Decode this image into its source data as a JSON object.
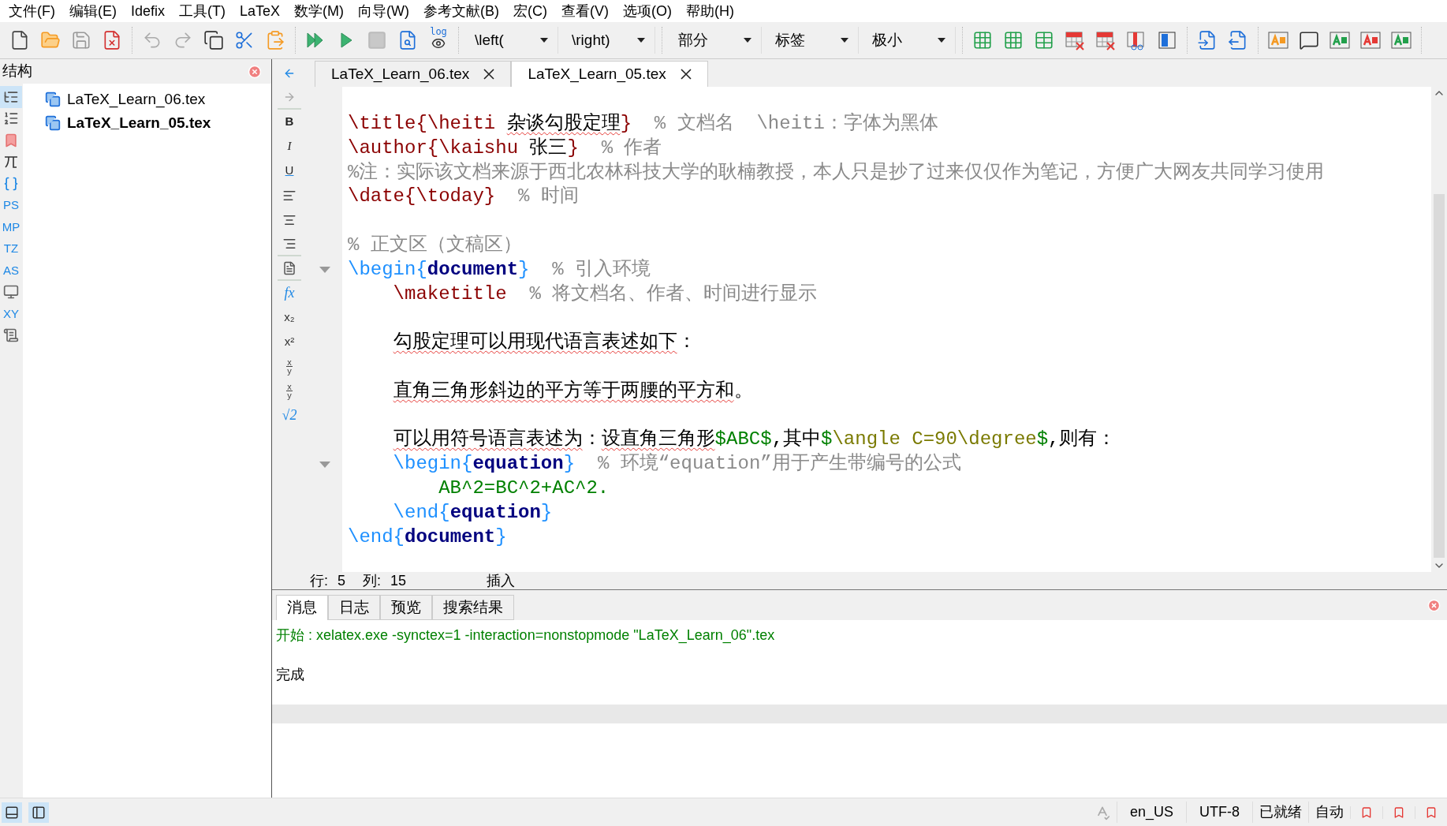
{
  "menu": [
    "文件(F)",
    "编辑(E)",
    "Idefix",
    "工具(T)",
    "LaTeX",
    "数学(M)",
    "向导(W)",
    "参考文献(B)",
    "宏(C)",
    "查看(V)",
    "选项(O)",
    "帮助(H)"
  ],
  "toolbar": [
    [
      {
        "kind": "new"
      },
      {
        "kind": "open"
      },
      {
        "kind": "save"
      },
      {
        "kind": "close"
      }
    ],
    [
      {
        "kind": "undo"
      },
      {
        "kind": "redo"
      },
      {
        "kind": "copy"
      },
      {
        "kind": "cut"
      },
      {
        "kind": "paste"
      }
    ],
    [
      {
        "kind": "quickbuild"
      },
      {
        "kind": "run"
      },
      {
        "kind": "stop"
      },
      {
        "kind": "view"
      },
      {
        "kind": "log",
        "label": "log"
      }
    ],
    [
      {
        "kind": "dropdown",
        "label": "\\left("
      },
      {
        "kind": "dropdown",
        "label": "\\right)"
      }
    ],
    [
      {
        "kind": "dropdown",
        "label": "部分"
      },
      {
        "kind": "dropdown",
        "label": "标签"
      },
      {
        "kind": "dropdown",
        "label": "极小"
      }
    ],
    [
      {
        "kind": "table",
        "color": "#22a04b"
      },
      {
        "kind": "table",
        "color": "#22a04b"
      },
      {
        "kind": "tablepaste",
        "color": "#22a04b"
      },
      {
        "kind": "tabledel",
        "color": "#e53935"
      },
      {
        "kind": "tabledel",
        "color": "#e53935"
      },
      {
        "kind": "tablecut",
        "color": "#e53935"
      },
      {
        "kind": "tablealign",
        "color": "#1e6fd9"
      }
    ],
    [
      {
        "kind": "docleft"
      },
      {
        "kind": "docright"
      }
    ],
    [
      {
        "kind": "textbox",
        "color": "#f59a23"
      },
      {
        "kind": "comment"
      },
      {
        "kind": "textbox",
        "color": "#22a04b"
      },
      {
        "kind": "textbox",
        "color": "#e53935"
      },
      {
        "kind": "textbox",
        "color": "#22a04b"
      }
    ]
  ],
  "structure": {
    "title": "结构",
    "tools": [
      {
        "kind": "tree",
        "selected": true
      },
      {
        "kind": "outline",
        "selected": false
      },
      {
        "kind": "bookmark",
        "selected": false
      },
      {
        "kind": "pi",
        "selected": false
      },
      {
        "kind": "braces",
        "selected": false
      },
      {
        "kind": "text",
        "label": "PS",
        "selected": false
      },
      {
        "kind": "text",
        "label": "MP",
        "selected": false
      },
      {
        "kind": "text",
        "label": "TZ",
        "selected": false
      },
      {
        "kind": "text",
        "label": "AS",
        "selected": false
      },
      {
        "kind": "screen",
        "selected": false
      },
      {
        "kind": "text",
        "label": "XY",
        "selected": false
      },
      {
        "kind": "script",
        "selected": false
      }
    ],
    "files": [
      {
        "name": "LaTeX_Learn_06.tex",
        "current": false
      },
      {
        "name": "LaTeX_Learn_05.tex",
        "current": true
      }
    ]
  },
  "format_bar": [
    {
      "kind": "back"
    },
    {
      "kind": "forward"
    },
    {
      "kind": "bold",
      "label": "B"
    },
    {
      "kind": "italic",
      "label": "I"
    },
    {
      "kind": "underline",
      "label": "U"
    },
    {
      "kind": "alignleft"
    },
    {
      "kind": "aligncenter"
    },
    {
      "kind": "alignright"
    },
    {
      "kind": "doc"
    },
    {
      "kind": "formula",
      "label": "fx"
    },
    {
      "kind": "script",
      "label": "x₂"
    },
    {
      "kind": "script",
      "label": "x²"
    },
    {
      "kind": "frac",
      "top": "x",
      "bottom": "y"
    },
    {
      "kind": "frac",
      "top": "x",
      "bottom": "y"
    },
    {
      "kind": "formula",
      "label": "√2"
    }
  ],
  "tabs": [
    {
      "label": "LaTeX_Learn_06.tex",
      "selected": false
    },
    {
      "label": "LaTeX_Learn_05.tex",
      "selected": true
    }
  ],
  "code": [
    {
      "fold": false,
      "segments": [
        {
          "kind": "cmd",
          "text": "\\title{\\heiti "
        },
        {
          "kind": "misspelled",
          "text": "杂谈勾股定理"
        },
        {
          "kind": "cmd",
          "text": "}"
        },
        {
          "kind": "comment",
          "text": "  % 文档名  \\heiti：字体为黑体"
        }
      ]
    },
    {
      "fold": false,
      "segments": [
        {
          "kind": "cmd",
          "text": "\\author{\\kaishu "
        },
        {
          "kind": "text",
          "text": "张三"
        },
        {
          "kind": "cmd",
          "text": "}"
        },
        {
          "kind": "comment",
          "text": "  % 作者"
        }
      ]
    },
    {
      "fold": false,
      "segments": [
        {
          "kind": "comment",
          "text": "%注：实际该文档来源于西北农林科技大学的耿楠教授，本人只是抄了过来仅仅作为笔记，方便广大网友共同学习使用"
        }
      ]
    },
    {
      "fold": false,
      "segments": [
        {
          "kind": "cmd",
          "text": "\\date{\\today}"
        },
        {
          "kind": "comment",
          "text": "  % 时间"
        }
      ]
    },
    {
      "fold": false
    },
    {
      "fold": false,
      "segments": [
        {
          "kind": "comment",
          "text": "% 正文区（文稿区）"
        }
      ]
    },
    {
      "fold": true,
      "segments": [
        {
          "kind": "env_cmd",
          "text": "\\begin{"
        },
        {
          "kind": "env_name",
          "text": "document"
        },
        {
          "kind": "env_cmd",
          "text": "}"
        },
        {
          "kind": "comment",
          "text": "  % 引入环境"
        }
      ]
    },
    {
      "fold": false,
      "segments": [
        {
          "kind": "cmd",
          "text": "    \\maketitle"
        },
        {
          "kind": "comment",
          "text": "  % 将文档名、作者、时间进行显示"
        }
      ]
    },
    {
      "fold": false
    },
    {
      "fold": false,
      "segments": [
        {
          "kind": "misspelled",
          "text": "    勾股定理可以用现代语言表述如下"
        },
        {
          "kind": "text",
          "text": "："
        }
      ]
    },
    {
      "fold": false
    },
    {
      "fold": false,
      "segments": [
        {
          "kind": "misspelled",
          "text": "    直角三角形斜边的平方等于两腰的平方和"
        },
        {
          "kind": "text",
          "text": "。"
        }
      ]
    },
    {
      "fold": false
    },
    {
      "fold": false,
      "segments": [
        {
          "kind": "misspelled",
          "text": "    可以用符号语言表述为"
        },
        {
          "kind": "text",
          "text": "："
        },
        {
          "kind": "misspelled",
          "text": "设直角三角形"
        },
        {
          "kind": "math",
          "text": "$ABC$"
        },
        {
          "kind": "text",
          "text": ",其中"
        },
        {
          "kind": "math",
          "text": "$"
        },
        {
          "kind": "math_cmd",
          "text": "\\angle C=90\\degree"
        },
        {
          "kind": "math",
          "text": "$"
        },
        {
          "kind": "text",
          "text": ",则有："
        }
      ]
    },
    {
      "fold": true,
      "segments": [
        {
          "kind": "env_cmd",
          "text": "    \\begin{"
        },
        {
          "kind": "env_name",
          "text": "equation"
        },
        {
          "kind": "env_cmd",
          "text": "}"
        },
        {
          "kind": "comment",
          "text": "  % 环境“equation”用于产生带编号的公式"
        }
      ]
    },
    {
      "fold": false,
      "segments": [
        {
          "kind": "math",
          "text": "        AB^2=BC^2+AC^2."
        }
      ]
    },
    {
      "fold": false,
      "segments": [
        {
          "kind": "env_cmd",
          "text": "    \\end{"
        },
        {
          "kind": "env_name",
          "text": "equation"
        },
        {
          "kind": "env_cmd",
          "text": "}"
        }
      ]
    },
    {
      "fold": false,
      "segments": [
        {
          "kind": "env_cmd",
          "text": "\\end{"
        },
        {
          "kind": "env_name",
          "text": "document"
        },
        {
          "kind": "env_cmd",
          "text": "}"
        }
      ]
    }
  ],
  "cursor_status": {
    "line_label": "行:",
    "line": "5",
    "col_label": "列:",
    "col": "15",
    "mode": "插入"
  },
  "messages_panel": {
    "tabs": [
      {
        "label": "消息",
        "selected": true
      },
      {
        "label": "日志",
        "selected": false
      },
      {
        "label": "预览",
        "selected": false
      },
      {
        "label": "搜索结果",
        "selected": false
      }
    ],
    "lines": [
      {
        "kind": "start",
        "text": "开始 : xelatex.exe -synctex=1 -interaction=nonstopmode \"LaTeX_Learn_06\".tex"
      },
      {
        "kind": "done",
        "text": "完成"
      }
    ]
  },
  "status_bar": {
    "language": "en_US",
    "encoding": "UTF-8",
    "state": "已就绪",
    "mode": "自动"
  }
}
